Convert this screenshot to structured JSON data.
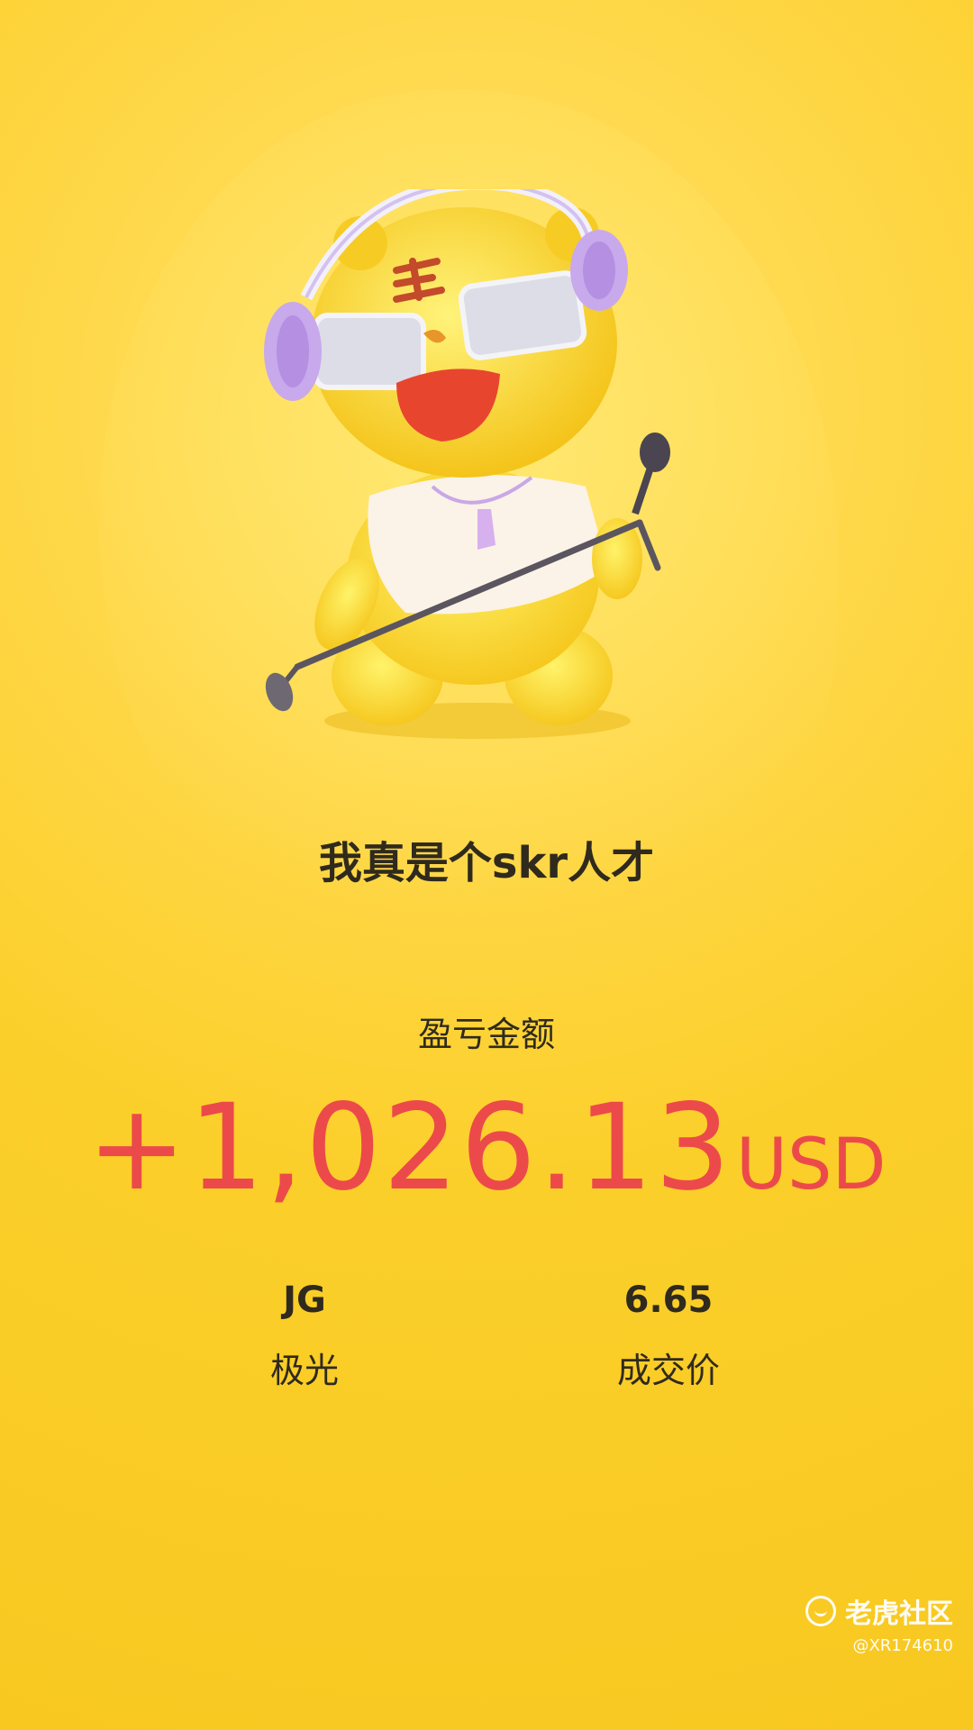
{
  "title": "我真是个skr人才",
  "pnl": {
    "label": "盈亏金额",
    "amount": "+1,026.13",
    "currency": "USD",
    "color": "#ec4a4a"
  },
  "stats": [
    {
      "value": "JG",
      "caption": "极光"
    },
    {
      "value": "6.65",
      "caption": "成交价"
    }
  ],
  "watermark": {
    "brand": "老虎社区",
    "user": "@XR174610"
  },
  "colors": {
    "background": "#fbcf2a",
    "text": "#2f2a1d"
  },
  "icons": [
    "tiger-mascot-illustration",
    "tiger-community-logo-icon"
  ]
}
